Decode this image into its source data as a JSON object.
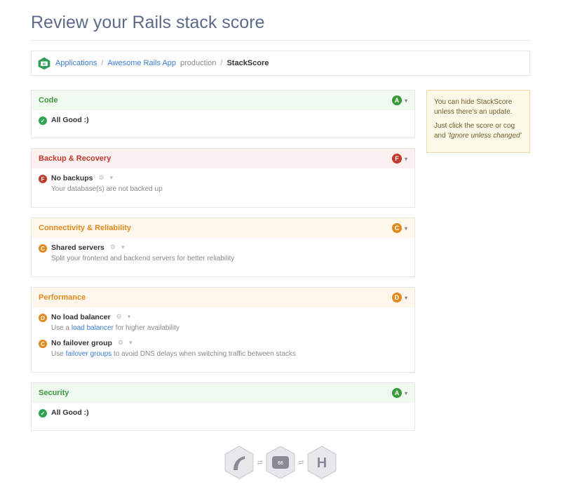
{
  "title": "Review your Rails stack score",
  "breadcrumb": {
    "applications": "Applications",
    "app_name": "Awesome Rails App",
    "env": "production",
    "current": "StackScore"
  },
  "sections": [
    {
      "title": "Code",
      "color": "green",
      "grade": "A",
      "items": [
        {
          "badge": "✓",
          "badge_color": "g-check",
          "title": "All Good :)",
          "gear": false
        }
      ]
    },
    {
      "title": "Backup & Recovery",
      "color": "red",
      "grade": "F",
      "items": [
        {
          "badge": "F",
          "badge_color": "g-f",
          "title": "No backups",
          "gear": true,
          "desc_parts": [
            {
              "t": "Your database(s) are not backed up"
            }
          ]
        }
      ]
    },
    {
      "title": "Connectivity & Reliability",
      "color": "orange",
      "grade": "C",
      "items": [
        {
          "badge": "C",
          "badge_color": "g-c",
          "title": "Shared servers",
          "gear": true,
          "desc_parts": [
            {
              "t": "Split your frontend and backend servers for better reliability"
            }
          ]
        }
      ]
    },
    {
      "title": "Performance",
      "color": "orange",
      "grade": "D",
      "items": [
        {
          "badge": "D",
          "badge_color": "g-d",
          "title": "No load balancer",
          "gear": true,
          "desc_parts": [
            {
              "t": "Use a "
            },
            {
              "t": "load balancer",
              "link": true
            },
            {
              "t": " for higher availability"
            }
          ]
        },
        {
          "badge": "C",
          "badge_color": "g-c",
          "title": "No failover group",
          "gear": true,
          "desc_parts": [
            {
              "t": "Use "
            },
            {
              "t": "failover groups",
              "link": true
            },
            {
              "t": " to avoid DNS delays when switching traffic between stacks"
            }
          ]
        }
      ]
    },
    {
      "title": "Security",
      "color": "green",
      "grade": "A",
      "items": [
        {
          "badge": "✓",
          "badge_color": "g-check",
          "title": "All Good :)",
          "gear": false
        }
      ]
    }
  ],
  "tip": {
    "line1": "You can hide StackScore unless there's an update.",
    "line2_a": "Just click the score or cog and ",
    "line2_b": "'Ignore unless changed'"
  },
  "footer_icons": [
    "rails-icon",
    "cloud66-icon",
    "heroku-icon"
  ]
}
